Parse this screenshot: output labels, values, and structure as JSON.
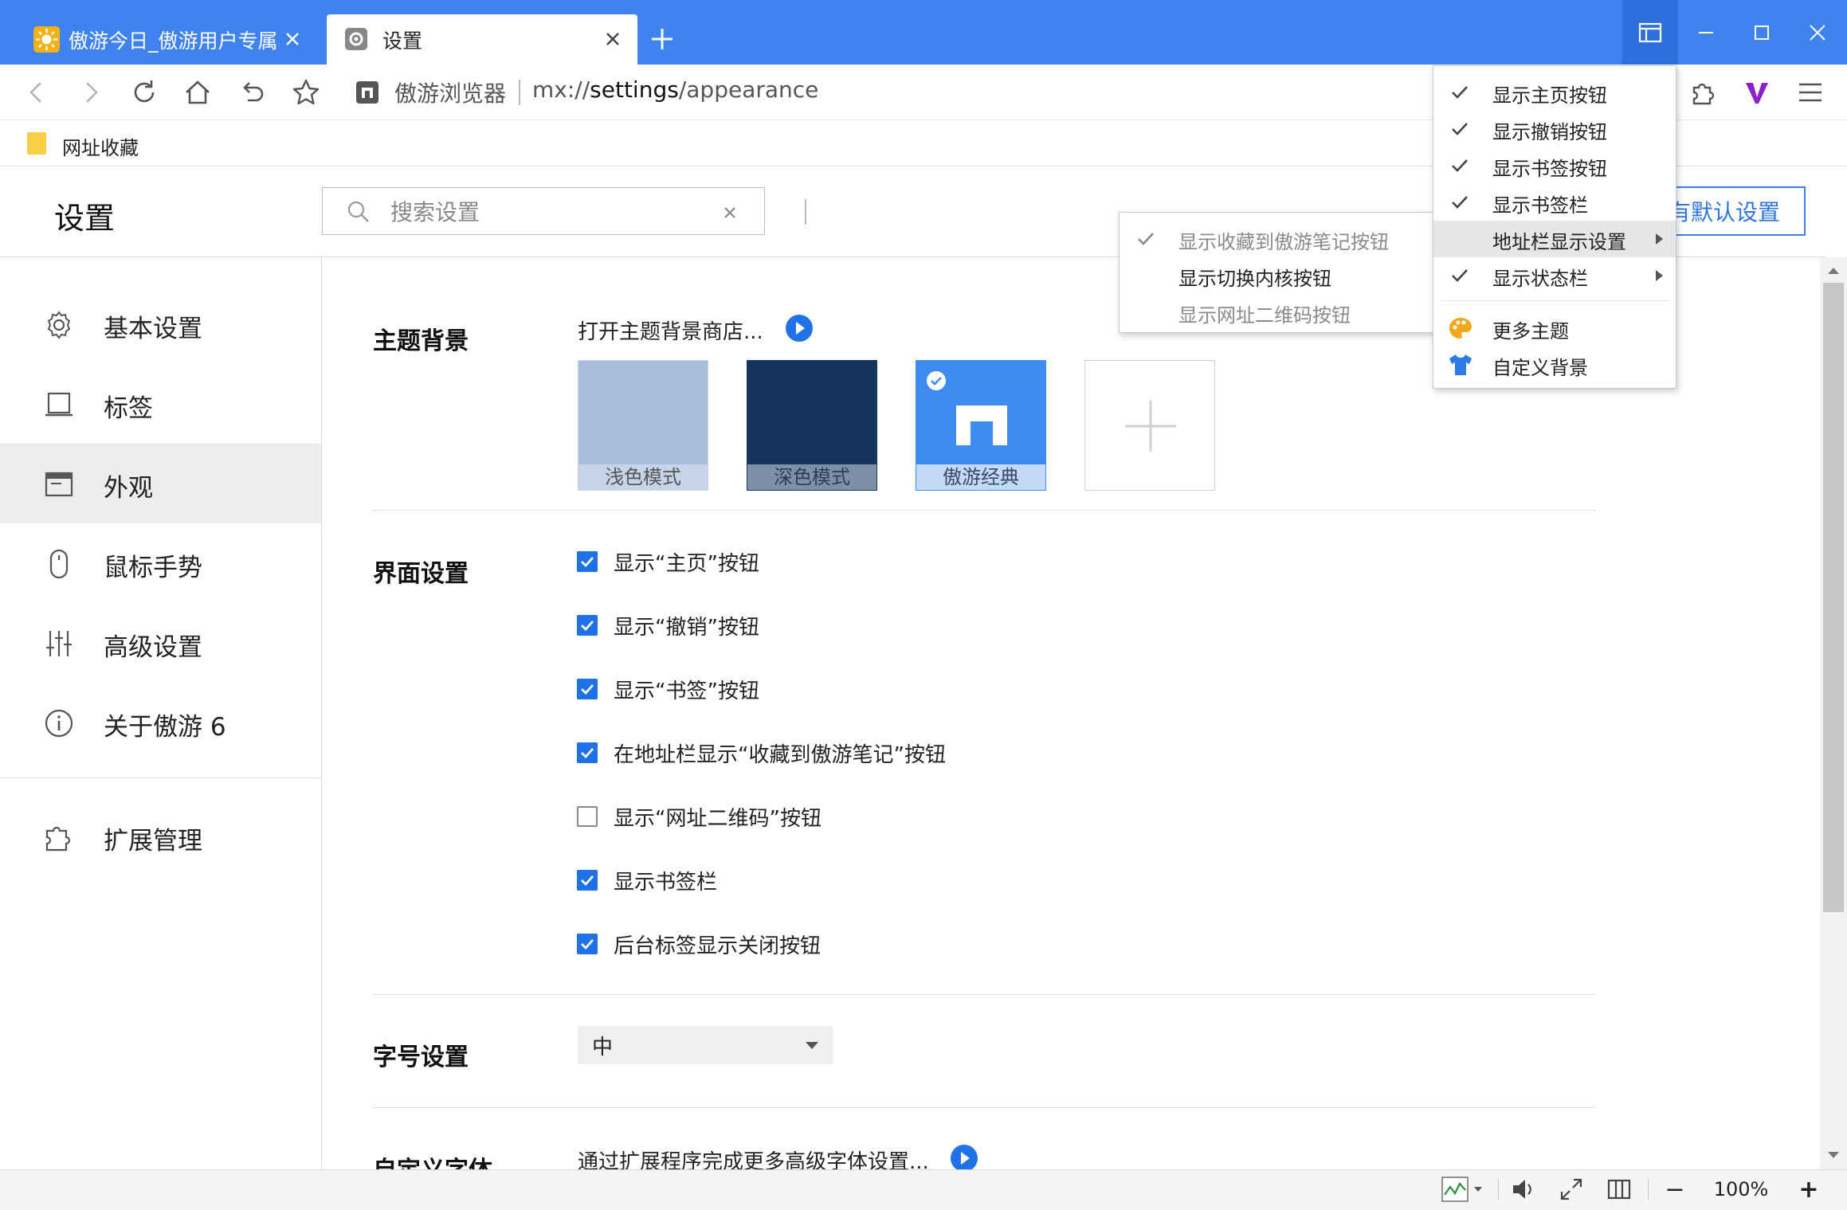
{
  "colors": {
    "tabbar": "#3f83ef",
    "accent": "#1f72e8",
    "checkbox_on": "#1f72e8"
  },
  "tabs": [
    {
      "label": "傲游今日_傲游用户专属",
      "active": false,
      "icon": "sun-icon"
    },
    {
      "label": "设置",
      "active": true,
      "icon": "gear-icon"
    }
  ],
  "addressbar": {
    "site_name": "傲游浏览器",
    "url_prefix": "mx://",
    "url_host": "settings",
    "url_path": "/appearance"
  },
  "bookmarks": [
    {
      "label": "网址收藏",
      "icon": "folder-icon"
    }
  ],
  "settings": {
    "title": "设置",
    "search_placeholder": "搜索设置",
    "reset_label": "有默认设置"
  },
  "sidebar": {
    "items": [
      {
        "label": "基本设置",
        "icon": "gear-icon"
      },
      {
        "label": "标签",
        "icon": "tab-icon"
      },
      {
        "label": "外观",
        "icon": "window-icon",
        "active": true
      },
      {
        "label": "鼠标手势",
        "icon": "mouse-icon"
      },
      {
        "label": "高级设置",
        "icon": "sliders-icon"
      },
      {
        "label": "关于傲游 6",
        "icon": "info-icon"
      }
    ],
    "extensions": {
      "label": "扩展管理",
      "icon": "puzzle-icon"
    }
  },
  "sections": {
    "theme": {
      "title": "主题背景",
      "store_link": "打开主题背景商店...",
      "cards": [
        {
          "label": "浅色模式",
          "selected": false
        },
        {
          "label": "深色模式",
          "selected": false
        },
        {
          "label": "傲游经典",
          "selected": true
        }
      ]
    },
    "interface": {
      "title": "界面设置",
      "options": [
        {
          "label": "显示“主页”按钮",
          "checked": true
        },
        {
          "label": "显示“撤销”按钮",
          "checked": true
        },
        {
          "label": "显示“书签”按钮",
          "checked": true
        },
        {
          "label": "在地址栏显示“收藏到傲游笔记”按钮",
          "checked": true
        },
        {
          "label": "显示“网址二维码”按钮",
          "checked": false
        },
        {
          "label": "显示书签栏",
          "checked": true
        },
        {
          "label": "后台标签显示关闭按钮",
          "checked": true
        }
      ]
    },
    "font_size": {
      "title": "字号设置",
      "value": "中"
    },
    "custom_font": {
      "title": "自定义字体",
      "link": "通过扩展程序完成更多高级字体设置..."
    }
  },
  "statusbar": {
    "zoom": "100%",
    "zoom_out": "−",
    "zoom_in": "+"
  },
  "menu_main": {
    "items": [
      {
        "label": "显示主页按钮",
        "checked": true
      },
      {
        "label": "显示撤销按钮",
        "checked": true
      },
      {
        "label": "显示书签按钮",
        "checked": true
      },
      {
        "label": "显示书签栏",
        "checked": true
      },
      {
        "label": "地址栏显示设置",
        "checked": false,
        "submenu": true,
        "highlighted": true
      },
      {
        "label": "显示状态栏",
        "checked": true,
        "submenu": true
      }
    ],
    "extra": [
      {
        "label": "更多主题",
        "icon": "palette-icon"
      },
      {
        "label": "自定义背景",
        "icon": "shirt-icon"
      }
    ]
  },
  "menu_sub": {
    "items": [
      {
        "label": "显示收藏到傲游笔记按钮",
        "checked": true,
        "disabled": true
      },
      {
        "label": "显示切换内核按钮",
        "checked": false,
        "disabled": false
      },
      {
        "label": "显示网址二维码按钮",
        "checked": false,
        "disabled": true
      }
    ]
  }
}
